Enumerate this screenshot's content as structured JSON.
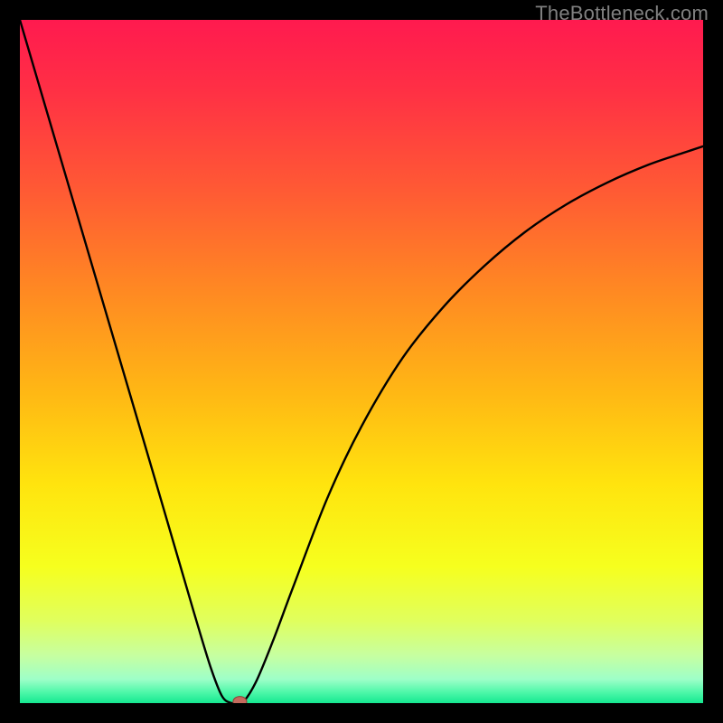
{
  "watermark": "TheBottleneck.com",
  "colors": {
    "page_bg": "#000000",
    "curve": "#000000",
    "marker_fill": "#c46a5d",
    "marker_stroke": "#8c3f36",
    "gradient_stops": [
      {
        "offset": 0.0,
        "color": "#ff1a4f"
      },
      {
        "offset": 0.1,
        "color": "#ff2f45"
      },
      {
        "offset": 0.25,
        "color": "#ff5a34"
      },
      {
        "offset": 0.4,
        "color": "#ff8a22"
      },
      {
        "offset": 0.55,
        "color": "#ffb914"
      },
      {
        "offset": 0.68,
        "color": "#ffe40e"
      },
      {
        "offset": 0.8,
        "color": "#f6ff1e"
      },
      {
        "offset": 0.88,
        "color": "#e0ff5e"
      },
      {
        "offset": 0.93,
        "color": "#c7ffa0"
      },
      {
        "offset": 0.965,
        "color": "#9effc8"
      },
      {
        "offset": 0.985,
        "color": "#4bf7a8"
      },
      {
        "offset": 1.0,
        "color": "#15e890"
      }
    ]
  },
  "chart_data": {
    "type": "line",
    "title": "",
    "xlabel": "",
    "ylabel": "",
    "xlim": [
      0,
      1
    ],
    "ylim": [
      0,
      1
    ],
    "series": [
      {
        "name": "bottleneck-curve",
        "x": [
          0.0,
          0.05,
          0.1,
          0.15,
          0.2,
          0.238,
          0.26,
          0.28,
          0.296,
          0.31,
          0.325,
          0.345,
          0.37,
          0.4,
          0.45,
          0.5,
          0.56,
          0.62,
          0.68,
          0.74,
          0.8,
          0.86,
          0.92,
          0.97,
          1.0
        ],
        "y": [
          1.0,
          0.83,
          0.66,
          0.49,
          0.32,
          0.19,
          0.115,
          0.05,
          0.01,
          0.0,
          0.0,
          0.03,
          0.09,
          0.17,
          0.3,
          0.405,
          0.505,
          0.58,
          0.64,
          0.69,
          0.73,
          0.762,
          0.788,
          0.805,
          0.815
        ]
      }
    ],
    "marker": {
      "x": 0.322,
      "y": 0.002,
      "r": 0.01
    }
  }
}
